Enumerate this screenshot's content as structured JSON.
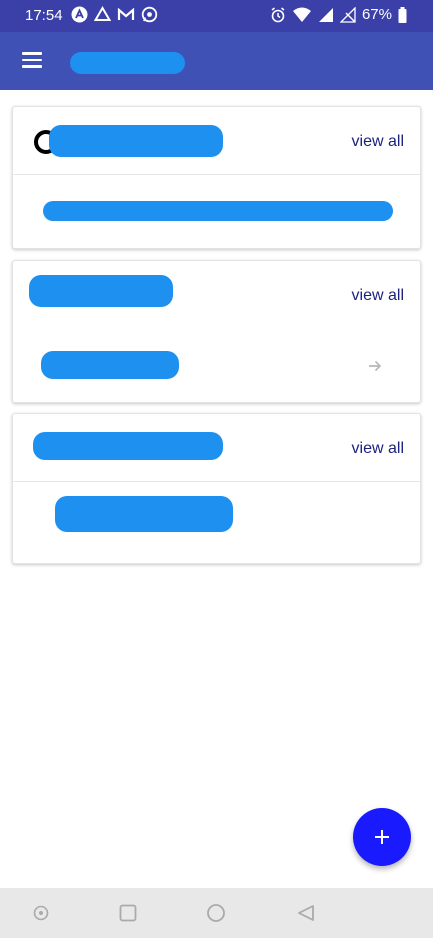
{
  "status_bar": {
    "time": "17:54",
    "battery": "67%",
    "notification_icons": [
      "app-icon",
      "drive-icon",
      "gmail-icon",
      "whatsapp-icon"
    ],
    "system_icons": [
      "alarm-icon",
      "wifi-icon",
      "signal-icon",
      "no-signal-icon",
      "battery-icon"
    ]
  },
  "app_bar": {
    "color": "#3f51b5",
    "menu_icon": "hamburger-menu-icon"
  },
  "cards": [
    {
      "action_label": "view all"
    },
    {
      "action_label": "view all",
      "row_icon": "arrow-right-icon"
    },
    {
      "action_label": "view all"
    }
  ],
  "fab": {
    "icon": "plus-icon",
    "color": "#1a1aff"
  },
  "nav_bar": {
    "icons": [
      "assistant-icon",
      "recents-icon",
      "home-icon",
      "back-icon"
    ]
  },
  "colors": {
    "status_bar": "#3b3fa8",
    "accent_text": "#1a237e",
    "redaction": "#1e90f0"
  }
}
